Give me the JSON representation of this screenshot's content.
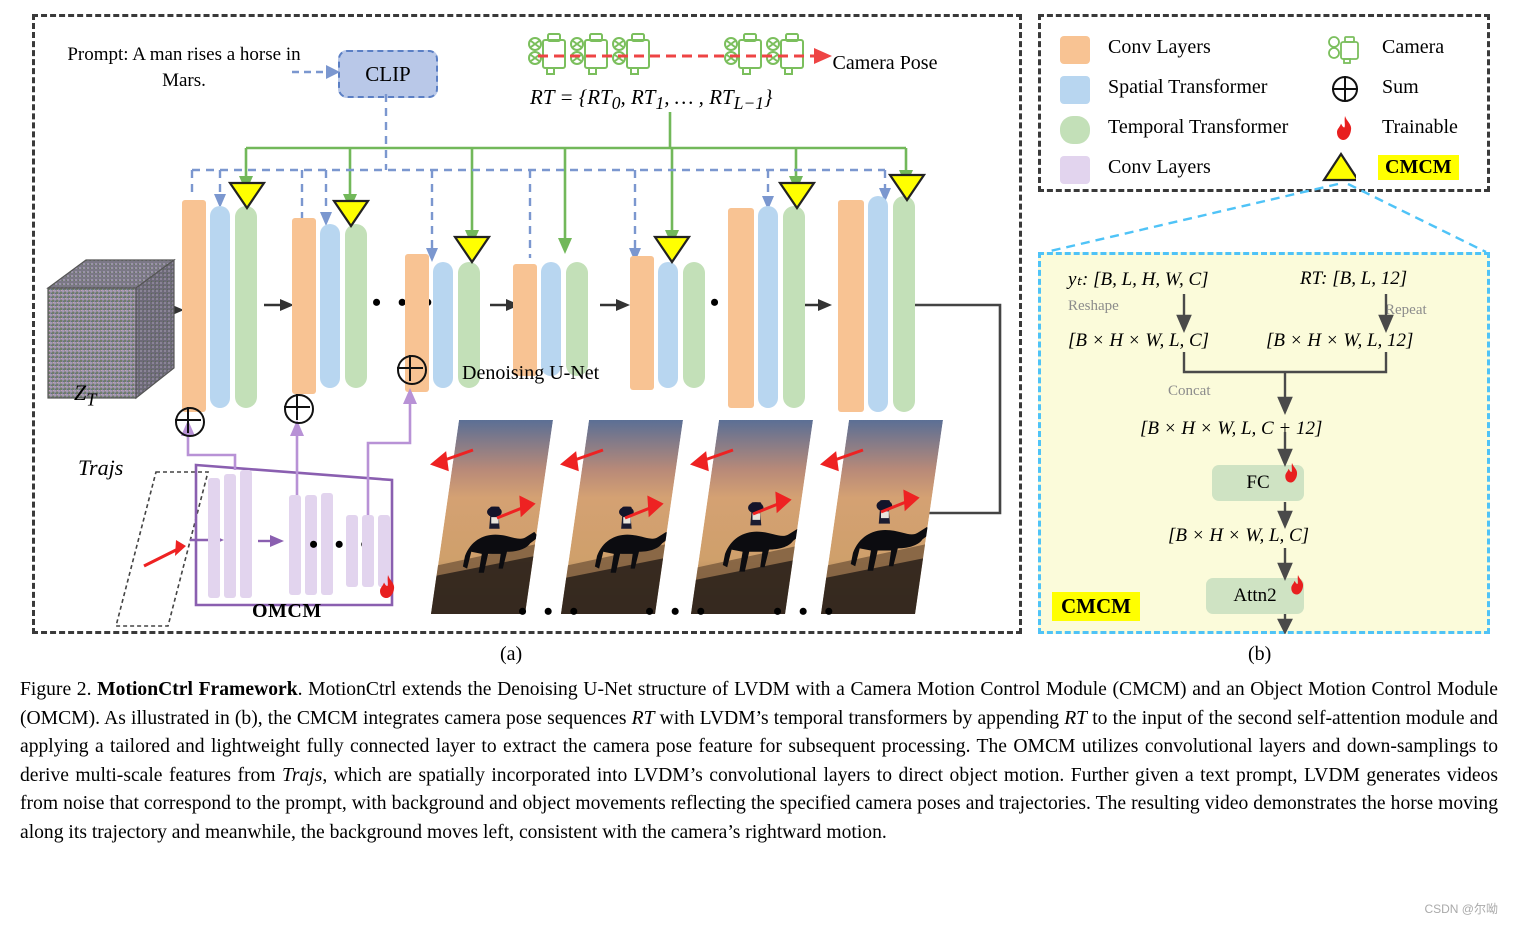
{
  "figure": {
    "number": "Figure 2.",
    "title": "MotionCtrl Framework",
    "caption_parts": [
      ". MotionCtrl extends the Denoising U-Net structure of LVDM with a Camera Motion Control Module (CMCM) and an Object Motion Control Module (OMCM). As illustrated in (b), the CMCM integrates camera pose sequences ",
      "RT",
      " with LVDM’s temporal transformers by appending ",
      "RT",
      " to the input of the second self-attention module and applying a tailored and lightweight fully connected layer to extract the camera pose feature for subsequent processing. The OMCM utilizes convolutional layers and down-samplings to derive multi-scale features from ",
      "Trajs",
      ", which are spatially incorporated into LVDM’s convolutional layers to direct object motion. Further given a text prompt, LVDM generates videos from noise that correspond to the prompt, with background and object movements reflecting the specified camera poses and trajectories. The resulting video demonstrates the horse moving along its trajectory and meanwhile, the background moves left, consistent with the camera’s rightward motion."
    ],
    "watermark": "CSDN @尔呦",
    "sub_a": "(a)",
    "sub_b": "(b)"
  },
  "panel_a": {
    "prompt": "Prompt: A man rises a horse in Mars.",
    "clip_label": "CLIP",
    "camera_pose_label": "Camera Pose",
    "rt_equation": "RT = {RT₀, RT₁, … , RTₗ₋₁}",
    "denoising_label": "Denoising  U-Net",
    "latent_label": "Zₜ",
    "trajs_label": "Trajs",
    "omcm_label": "OMCM",
    "ellipsis": "• • •"
  },
  "legend": {
    "left_items": [
      {
        "label": "Conv Layers",
        "color": "#f8c393",
        "shape": "square"
      },
      {
        "label": "Spatial Transformer",
        "color": "#b8d6f0",
        "shape": "square"
      },
      {
        "label": "Temporal Transformer",
        "color": "#c3e0b8",
        "shape": "round"
      },
      {
        "label": "Conv Layers",
        "color": "#e2d4ee",
        "shape": "square"
      }
    ],
    "right_items": [
      {
        "label": "Camera",
        "icon": "camera-icon"
      },
      {
        "label": "Sum",
        "icon": "sum-icon"
      },
      {
        "label": "Trainable",
        "icon": "flame-icon"
      },
      {
        "label": "CMCM",
        "icon": "yellow-triangle-icon"
      }
    ]
  },
  "cmcm": {
    "title": "CMCM",
    "input_left": "yₜ: [B, L, H, W, C]",
    "input_right": "RT: [B, L, 12]",
    "op_reshape": "Reshape",
    "op_repeat": "Repeat",
    "shape_left": "[B × H × W, L, C]",
    "shape_right": "[B × H × W, L, 12]",
    "op_concat": "Concat",
    "shape_concat": "[B × H × W, L, C + 12]",
    "node_fc": "FC",
    "shape_after_fc": "[B × H × W, L, C]",
    "node_attn2": "Attn2"
  },
  "colors": {
    "conv": "#f8c393",
    "spatial": "#b8d6f0",
    "temporal": "#c3e0b8",
    "omcm_conv": "#e2d4ee",
    "cmcm_marker": "#ffff00",
    "camera_green": "#72b85a",
    "clip_blue": "#7b97cf",
    "traj_red": "#ee2222",
    "omcm_purple": "#8a5fb0",
    "cmcm_panel_bg": "#fbfbda",
    "cmcm_panel_border": "#4fc3f7",
    "node_green": "#cfe3c3"
  }
}
